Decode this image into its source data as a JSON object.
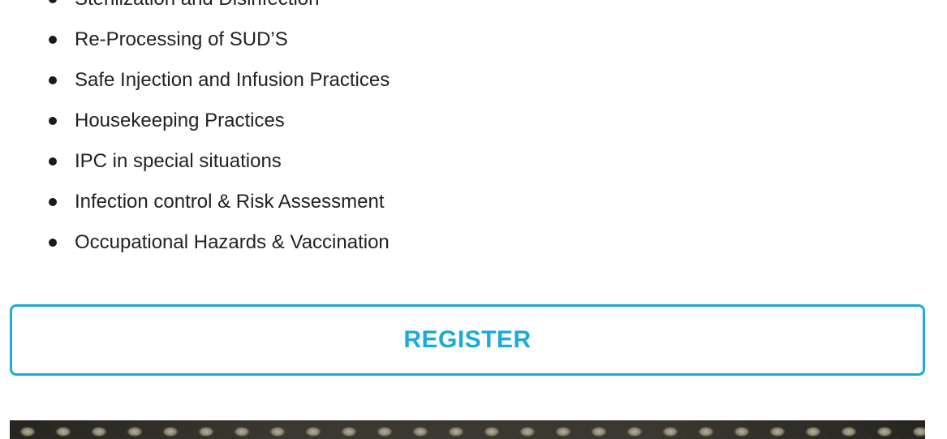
{
  "topics": {
    "items": [
      "Sterilization and Disinfection",
      "Re-Processing of SUD’S",
      "Safe Injection and Infusion Practices",
      "Housekeeping Practices",
      "IPC in special situations",
      "Infection control & Risk Assessment",
      "Occupational Hazards & Vaccination"
    ]
  },
  "register": {
    "label": "REGISTER"
  },
  "colors": {
    "accent": "#1aabd8",
    "text": "#222222",
    "footer_band": "#3a3830"
  }
}
